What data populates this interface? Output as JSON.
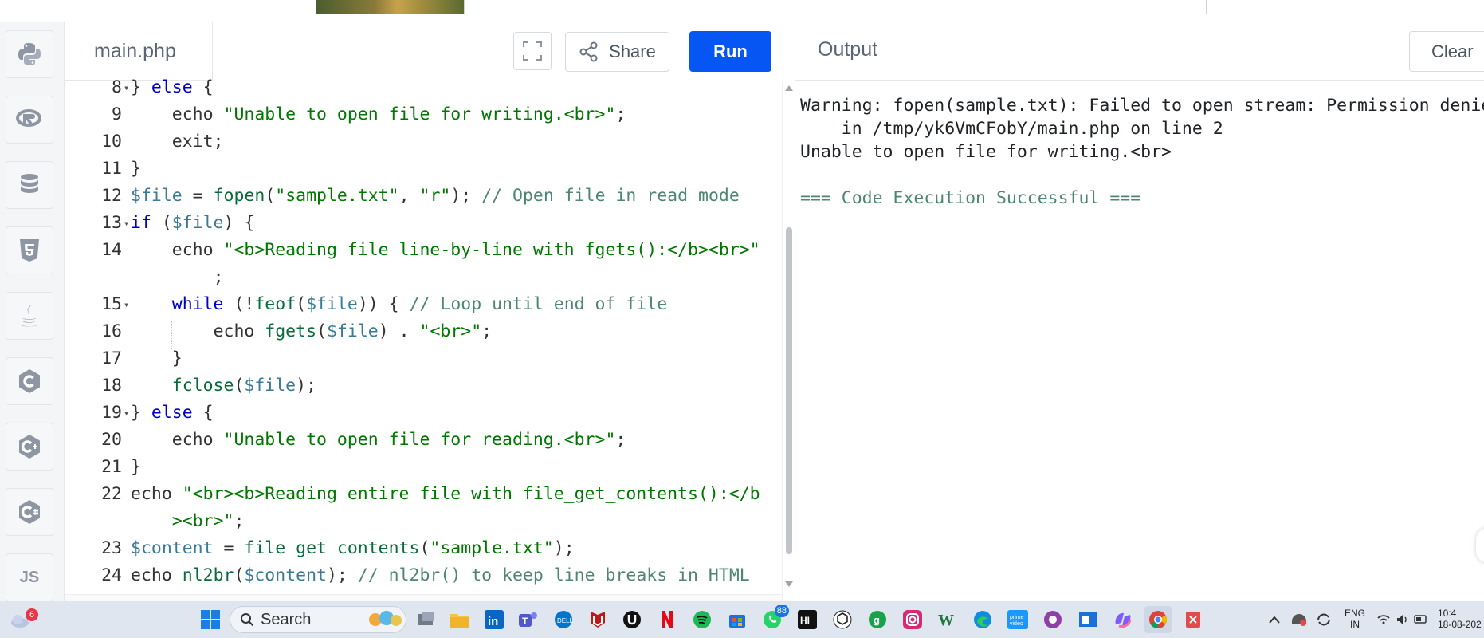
{
  "editor": {
    "file_tab": "main.php",
    "share_label": "Share",
    "run_label": "Run",
    "lines": [
      {
        "num": "8",
        "fold": true,
        "html": "<span>} </span><span class=\"kw\">else</span><span> {</span>"
      },
      {
        "num": "9",
        "fold": false,
        "html": "    <span>echo </span><span class=\"str\">\"Unable to open file for writing.&lt;br&gt;\"</span><span>;</span>"
      },
      {
        "num": "10",
        "fold": false,
        "html": "    <span>exit;</span>"
      },
      {
        "num": "11",
        "fold": false,
        "html": "<span>}</span>"
      },
      {
        "num": "12",
        "fold": false,
        "html": "<span class=\"var\">$file</span><span> = </span><span class=\"fn\">fopen</span><span>(</span><span class=\"str\">\"sample.txt\"</span><span>, </span><span class=\"str\">\"r\"</span><span>); </span><span class=\"cmt\">// Open file in read mode</span>"
      },
      {
        "num": "13",
        "fold": true,
        "html": "<span class=\"kw\">if</span><span> (</span><span class=\"var\">$file</span><span>) {</span>"
      },
      {
        "num": "14",
        "fold": false,
        "html": "    <span>echo </span><span class=\"str\">\"&lt;b&gt;Reading file line-by-line with fgets():&lt;/b&gt;&lt;br&gt;\"</span>"
      },
      {
        "num": "",
        "fold": false,
        "html": "        <span>;</span>"
      },
      {
        "num": "15",
        "fold": true,
        "html": "    <span class=\"kw\">while</span><span> (!</span><span class=\"fn\">feof</span><span>(</span><span class=\"var\">$file</span><span>)) { </span><span class=\"cmt\">// Loop until end of file</span>"
      },
      {
        "num": "16",
        "fold": false,
        "html": "        <span>echo </span><span class=\"fn\">fgets</span><span>(</span><span class=\"var\">$file</span><span>) . </span><span class=\"str\">\"&lt;br&gt;\"</span><span>;</span>"
      },
      {
        "num": "17",
        "fold": false,
        "html": "    <span>}</span>"
      },
      {
        "num": "18",
        "fold": false,
        "html": "    <span class=\"fn\">fclose</span><span>(</span><span class=\"var\">$file</span><span>);</span>"
      },
      {
        "num": "19",
        "fold": true,
        "html": "<span>} </span><span class=\"kw\">else</span><span> {</span>"
      },
      {
        "num": "20",
        "fold": false,
        "html": "    <span>echo </span><span class=\"str\">\"Unable to open file for reading.&lt;br&gt;\"</span><span>;</span>"
      },
      {
        "num": "21",
        "fold": false,
        "html": "<span>}</span>"
      },
      {
        "num": "22",
        "fold": false,
        "html": "<span>echo </span><span class=\"str\">\"&lt;br&gt;&lt;b&gt;Reading entire file with file_get_contents():&lt;/b</span>"
      },
      {
        "num": "",
        "fold": false,
        "html": "    <span class=\"str\">&gt;&lt;br&gt;\"</span><span>;</span>"
      },
      {
        "num": "23",
        "fold": false,
        "html": "<span class=\"var\">$content</span><span> = </span><span class=\"fn\">file_get_contents</span><span>(</span><span class=\"str\">\"sample.txt\"</span><span>);</span>"
      },
      {
        "num": "24",
        "fold": false,
        "html": "<span>echo </span><span class=\"fn\">nl2br</span><span>(</span><span class=\"var\">$content</span><span>); </span><span class=\"cmt\">// nl2br() to keep line breaks in HTML</span>"
      }
    ]
  },
  "output": {
    "title": "Output",
    "clear_label": "Clear",
    "lines": [
      "",
      "Warning: fopen(sample.txt): Failed to open stream: Permission denie",
      "    in /tmp/yk6VmCFobY/main.php on line 2",
      "Unable to open file for writing.<br>",
      "",
      "=== Code Execution Successful ==="
    ]
  },
  "sidebar": {
    "languages": [
      "python-icon",
      "r-icon",
      "sql-database-icon",
      "html5-icon",
      "java-icon",
      "c-icon",
      "cpp-icon",
      "csharp-icon",
      "js-icon"
    ],
    "js_label": "JS"
  },
  "taskbar": {
    "search_label": "Search",
    "weather_badge": "6",
    "whatsapp_badge": "88",
    "language_line1": "ENG",
    "language_line2": "IN",
    "time": "10:4",
    "date": "18-08-202"
  },
  "colors": {
    "run_button": "#0556f3",
    "keyword": "#0000cc",
    "string": "#007700",
    "variable": "#3b7a95",
    "comment": "#4e8575"
  }
}
